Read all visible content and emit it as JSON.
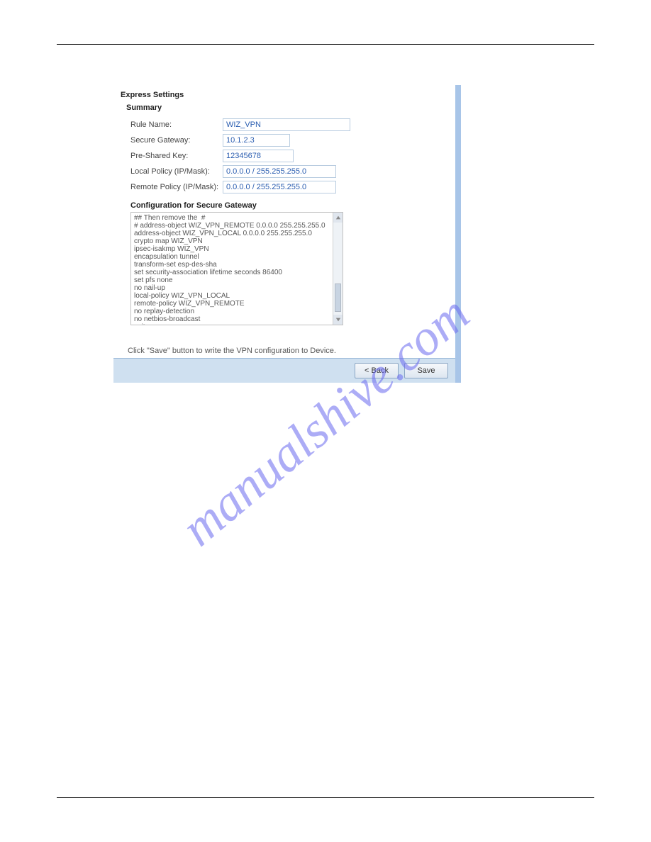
{
  "watermark": "manualshive.com",
  "dialog": {
    "section_title": "Express Settings",
    "summary_title": "Summary",
    "fields": {
      "rule_name": {
        "label": "Rule Name:",
        "value": "WIZ_VPN"
      },
      "secure_gateway": {
        "label": "Secure Gateway:",
        "value": "10.1.2.3"
      },
      "preshared_key": {
        "label": "Pre-Shared Key:",
        "value": "12345678"
      },
      "local_policy": {
        "label": "Local Policy (IP/Mask):",
        "value": "0.0.0.0 / 255.255.255.0"
      },
      "remote_policy": {
        "label": "Remote Policy (IP/Mask):",
        "value": "0.0.0.0 / 255.255.255.0"
      }
    },
    "config_title": "Configuration for Secure Gateway",
    "config_text": "## Then remove the  #\n# address-object WIZ_VPN_REMOTE 0.0.0.0 255.255.255.0\naddress-object WIZ_VPN_LOCAL 0.0.0.0 255.255.255.0\ncrypto map WIZ_VPN\nipsec-isakmp WIZ_VPN\nencapsulation tunnel\ntransform-set esp-des-sha\nset security-association lifetime seconds 86400\nset pfs none\nno nail-up\nlocal-policy WIZ_VPN_LOCAL\nremote-policy WIZ_VPN_REMOTE\nno replay-detection\nno netbios-broadcast\nexit",
    "hint": "Click \"Save\" button to write the VPN configuration to Device.",
    "buttons": {
      "back": "< Back",
      "save": "Save"
    }
  }
}
